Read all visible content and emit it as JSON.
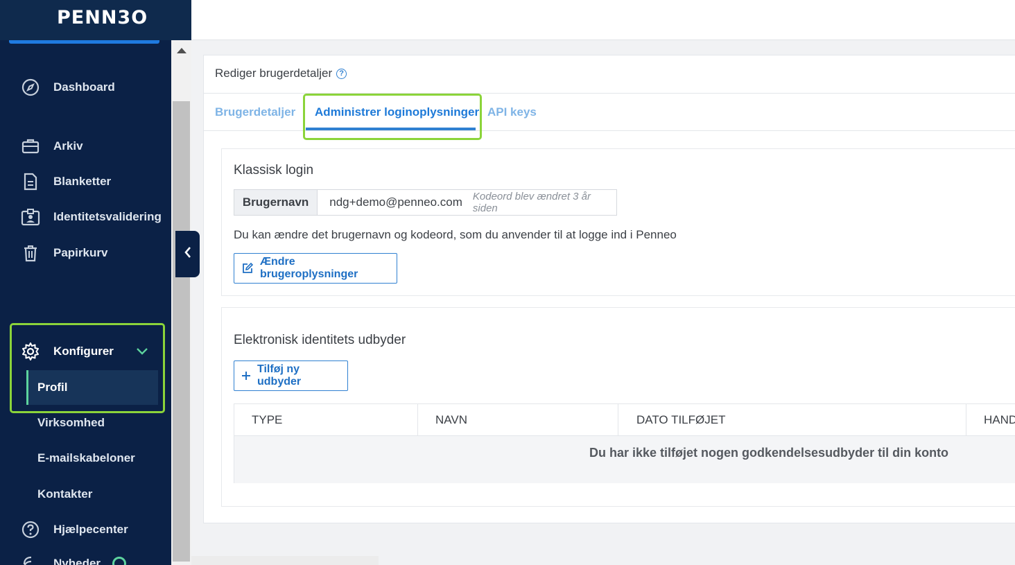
{
  "brand": {
    "logo_text": "PENN3O",
    "accent": "#1f7ae0",
    "sidebar_bg": "#0b2146",
    "highlight": "#8bd43a"
  },
  "sidebar": {
    "items": [
      {
        "label": "Dashboard",
        "icon": "compass-icon"
      },
      {
        "label": "Arkiv",
        "icon": "briefcase-icon"
      },
      {
        "label": "Blanketter",
        "icon": "document-icon"
      },
      {
        "label": "Identitetsvalidering",
        "icon": "id-badge-icon"
      },
      {
        "label": "Papirkurv",
        "icon": "trash-icon"
      }
    ],
    "config": {
      "label": "Konfigurer",
      "icon": "gear-icon",
      "expanded": true,
      "children": [
        {
          "label": "Profil",
          "selected": true
        },
        {
          "label": "Virksomhed"
        },
        {
          "label": "E-mailskabeloner"
        },
        {
          "label": "Kontakter"
        }
      ]
    },
    "help": {
      "label": "Hjælpecenter",
      "icon": "help-circle-icon"
    },
    "news": {
      "label": "Nyheder",
      "icon": "broadcast-icon"
    }
  },
  "page": {
    "title": "Rediger brugerdetaljer",
    "tabs": [
      {
        "label": "Brugerdetaljer",
        "active": false
      },
      {
        "label": "Administrer loginoplysninger",
        "active": true
      },
      {
        "label": "API keys",
        "active": false
      }
    ]
  },
  "classic_login": {
    "title": "Klassisk login",
    "field_label": "Brugernavn",
    "username": "ndg+demo@penneo.com",
    "password_hint": "Kodeord blev ændret 3 år siden",
    "description": "Du kan ændre det brugernavn og kodeord, som du anvender til at logge ind i Penneo",
    "edit_button": "Ændre brugeroplysninger"
  },
  "eid_provider": {
    "title": "Elektronisk identitets udbyder",
    "add_button": "Tilføj ny udbyder",
    "columns": [
      "TYPE",
      "NAVN",
      "DATO TILFØJET",
      "HAND"
    ],
    "empty_message": "Du har ikke tilføjet nogen godkendelsesudbyder til din konto"
  }
}
